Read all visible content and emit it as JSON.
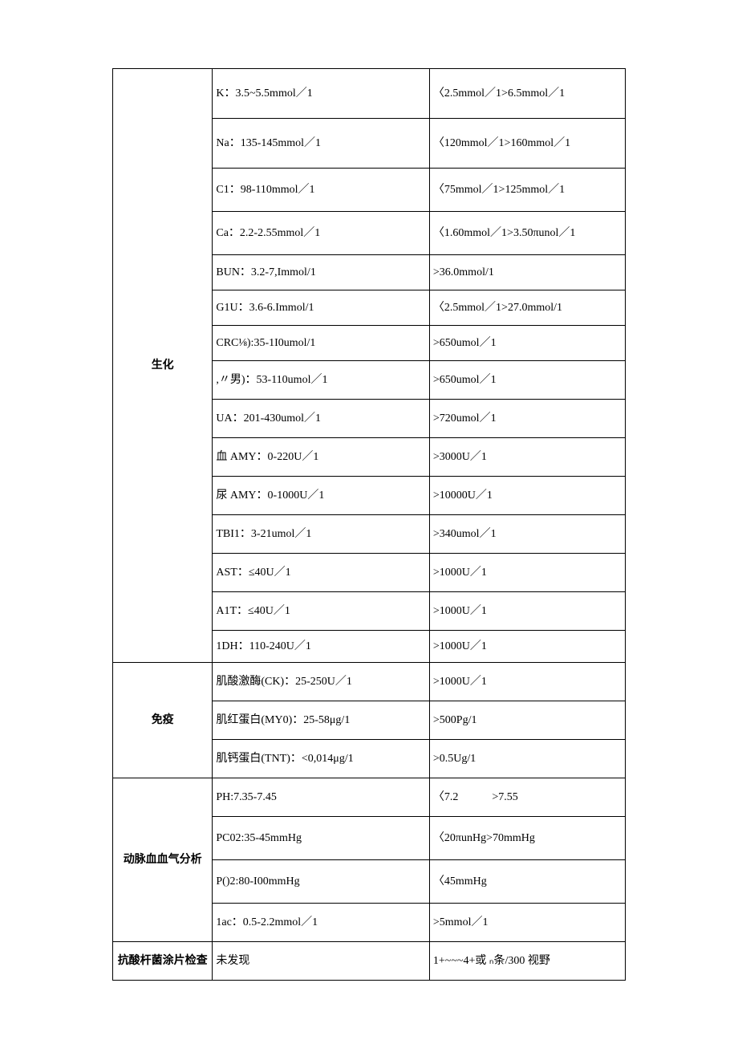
{
  "sections": [
    {
      "category": "生化",
      "rows": [
        {
          "item": "K：3.5~5.5mmol／1",
          "critical": "〈2.5mmol／1>6.5mmol／1",
          "h": "h-tall"
        },
        {
          "item": "Na：135-145mmol／1",
          "critical": "〈120mmol／1>160mmol／1",
          "h": "h-tall"
        },
        {
          "item": "C1：98-110mmol／1",
          "critical": "〈75mmol／1>125mmol／1",
          "h": "h-med"
        },
        {
          "item": "Ca：2.2-2.55mmol／1",
          "critical": "〈1.60mmol／1>3.50πunol／1",
          "h": "h-med"
        },
        {
          "item": "BUN：3.2-7,Immol/1",
          "critical": ">36.0mmol/1",
          "h": "h-small"
        },
        {
          "item": "G1U：3.6-6.Immol/1",
          "critical": "〈2.5mmol／1>27.0mmol/1",
          "h": "h-small"
        },
        {
          "item": "CRC⅛):35-1I0umol/1",
          "critical": ">650umol／1",
          "h": "h-small"
        },
        {
          "item": ",〃男)：53-110umol／1",
          "critical": ">650umol／1",
          "h": "h-mid"
        },
        {
          "item": "UA：201-430umol／1",
          "critical": ">720umol／1",
          "h": "h-mid"
        },
        {
          "item": "血 AMY：0-220U／1",
          "critical": ">3000U／1",
          "h": "h-mid"
        },
        {
          "item": "尿 AMY：0-1000U／1",
          "critical": ">10000U／1",
          "h": "h-mid"
        },
        {
          "item": "TBI1：3-21umol／1",
          "critical": ">340umol／1",
          "h": "h-mid"
        },
        {
          "item": "AST：≤40U／1",
          "critical": ">1000U／1",
          "h": "h-mid"
        },
        {
          "item": "A1T：≤40U／1",
          "critical": ">1000U／1",
          "h": "h-mid"
        },
        {
          "item": "1DH：110-240U／1",
          "critical": ">1000U／1",
          "h": "h-norm"
        }
      ]
    },
    {
      "category": "免疫",
      "rows": [
        {
          "item": "肌酸激酶(CK)：25-250U／1",
          "critical": ">1000U／1",
          "h": "h-mid"
        },
        {
          "item": "肌红蛋白(MY0)：25-58μg/1",
          "critical": ">500Pg/1",
          "h": "h-mid"
        },
        {
          "item": "肌钙蛋白(TNT)：<0,014μg/1",
          "critical": ">0.5Ug/1",
          "h": "h-mid"
        }
      ]
    },
    {
      "category": "动脉血血气分析",
      "rows": [
        {
          "item": "PH:7.35-7.45",
          "critical": "〈7.2　　　>7.55",
          "h": "h-mid"
        },
        {
          "item": "PC02:35-45mmHg",
          "critical": "〈20πunHg>70mmHg",
          "h": "h-med"
        },
        {
          "item": "P()2:80-I00mmHg",
          "critical": "〈45mmHg",
          "h": "h-med"
        },
        {
          "item": "1ac：0.5-2.2mmol／1",
          "critical": ">5mmol／1",
          "h": "h-mid"
        }
      ]
    },
    {
      "category": "抗酸杆菌涂片检查",
      "rows": [
        {
          "item": "未发现",
          "critical": "1+~~~4+或 ₙ条/300 视野",
          "h": "h-mid"
        }
      ]
    }
  ]
}
